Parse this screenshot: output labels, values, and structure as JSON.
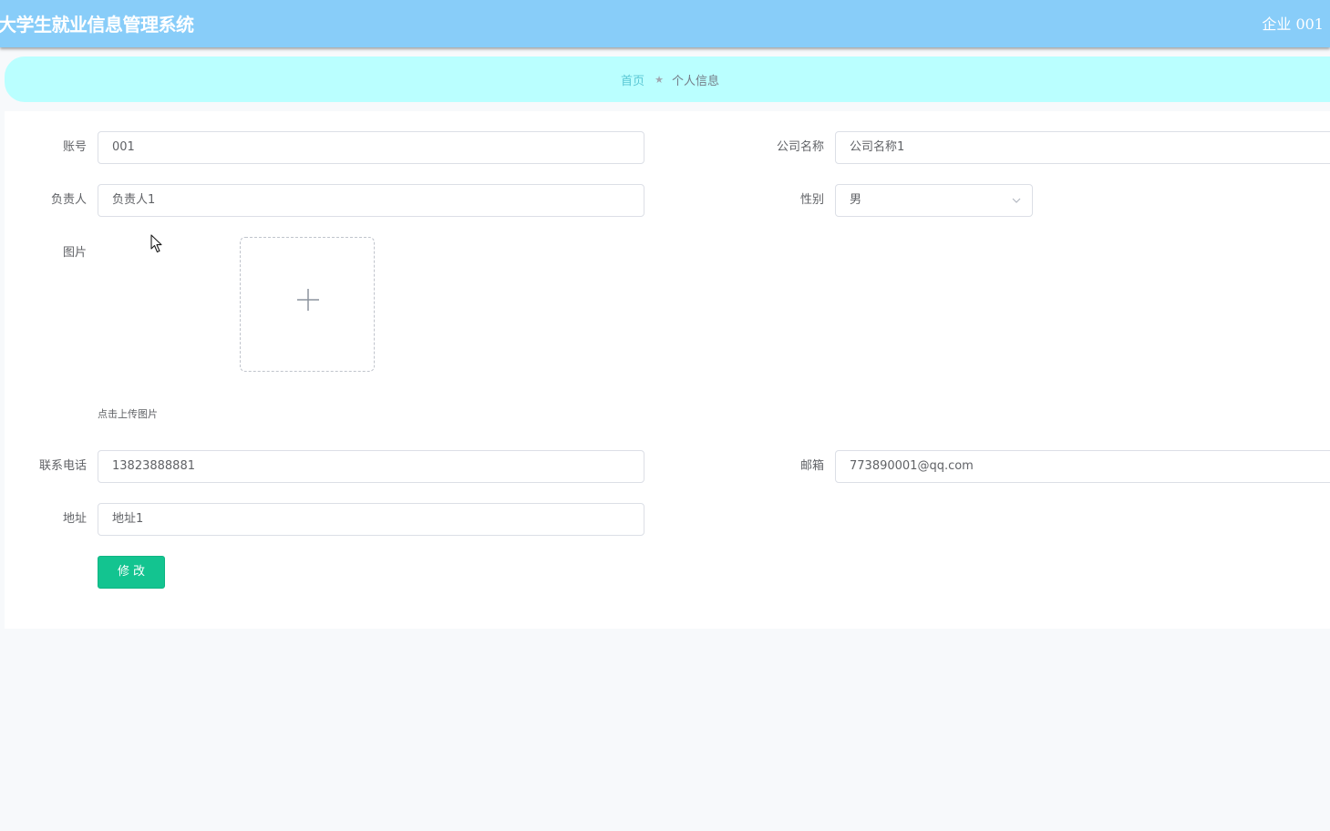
{
  "header": {
    "app_title": "大学生就业信息管理系统",
    "user_name": "企业 001"
  },
  "breadcrumb": {
    "home": "首页",
    "separator": "★",
    "current": "个人信息"
  },
  "form": {
    "account": {
      "label": "账号",
      "value": "001"
    },
    "company_name": {
      "label": "公司名称",
      "value": "公司名称1"
    },
    "manager": {
      "label": "负责人",
      "value": "负责人1"
    },
    "gender": {
      "label": "性别",
      "value": "男"
    },
    "picture": {
      "label": "图片",
      "tip": "点击上传图片"
    },
    "phone": {
      "label": "联系电话",
      "value": "13823888881"
    },
    "email": {
      "label": "邮箱",
      "value": "773890001@qq.com"
    },
    "address": {
      "label": "地址",
      "value": "地址1"
    },
    "submit_label": "修改"
  },
  "colors": {
    "header_bg": "#88cdf9",
    "breadcrumb_bg": "#baffff",
    "primary_button": "#13c490"
  },
  "icons": {
    "upload": "plus-icon",
    "select": "chevron-down-icon",
    "cursor": "mouse-pointer-icon"
  }
}
